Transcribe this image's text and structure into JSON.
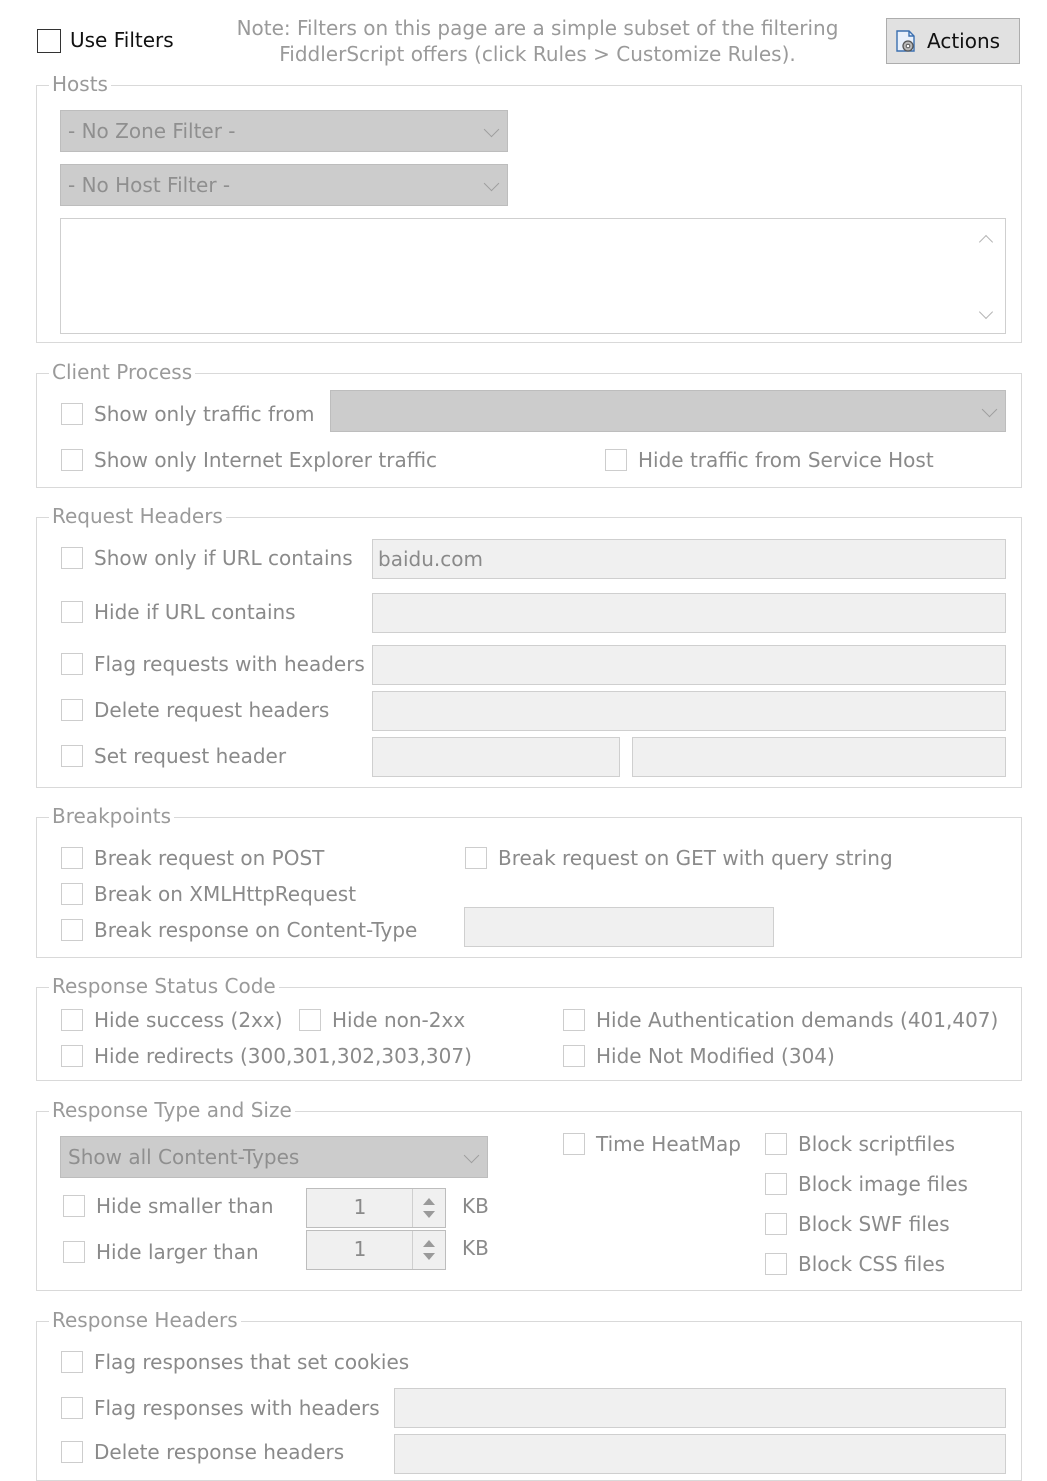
{
  "top": {
    "use_filters_label": "Use Filters",
    "note_line1": "Note: Filters on this page are a simple subset of the filtering",
    "note_line2": "FiddlerScript offers (click Rules > Customize Rules).",
    "actions_label": "Actions",
    "actions_icon": "gear-document-icon"
  },
  "hosts": {
    "legend": "Hosts",
    "zone_filter": "- No Zone Filter -",
    "host_filter": "- No Host Filter -"
  },
  "client_process": {
    "legend": "Client Process",
    "show_only_traffic_from": "Show only traffic from",
    "show_only_ie": "Show only Internet Explorer traffic",
    "hide_service_host": "Hide traffic from Service Host"
  },
  "request_headers": {
    "legend": "Request Headers",
    "show_only_if_url": "Show only if URL contains",
    "url_contains_value": "baidu.com",
    "hide_if_url": "Hide if URL contains",
    "flag_requests": "Flag requests with headers",
    "delete_request_headers": "Delete request headers",
    "set_request_header": "Set request header"
  },
  "breakpoints": {
    "legend": "Breakpoints",
    "break_post": "Break request on POST",
    "break_get": "Break request on GET with query string",
    "break_xhr": "Break on XMLHttpRequest",
    "break_content_type": "Break response on Content-Type"
  },
  "status_code": {
    "legend": "Response Status Code",
    "hide_success": "Hide success (2xx)",
    "hide_non2xx": "Hide non-2xx",
    "hide_auth": "Hide Authentication demands (401,407)",
    "hide_redirects": "Hide redirects (300,301,302,303,307)",
    "hide_not_modified": "Hide Not Modified (304)"
  },
  "type_size": {
    "legend": "Response Type and Size",
    "content_types": "Show all Content-Types",
    "hide_smaller": "Hide smaller than",
    "smaller_value": "1",
    "hide_larger": "Hide larger than",
    "larger_value": "1",
    "kb": "KB",
    "time_heatmap": "Time HeatMap",
    "block_script": "Block scriptfiles",
    "block_image": "Block image files",
    "block_swf": "Block SWF files",
    "block_css": "Block CSS files"
  },
  "response_headers": {
    "legend": "Response Headers",
    "flag_cookies": "Flag responses that set cookies",
    "flag_responses": "Flag responses with headers",
    "delete_response_headers": "Delete response headers"
  }
}
